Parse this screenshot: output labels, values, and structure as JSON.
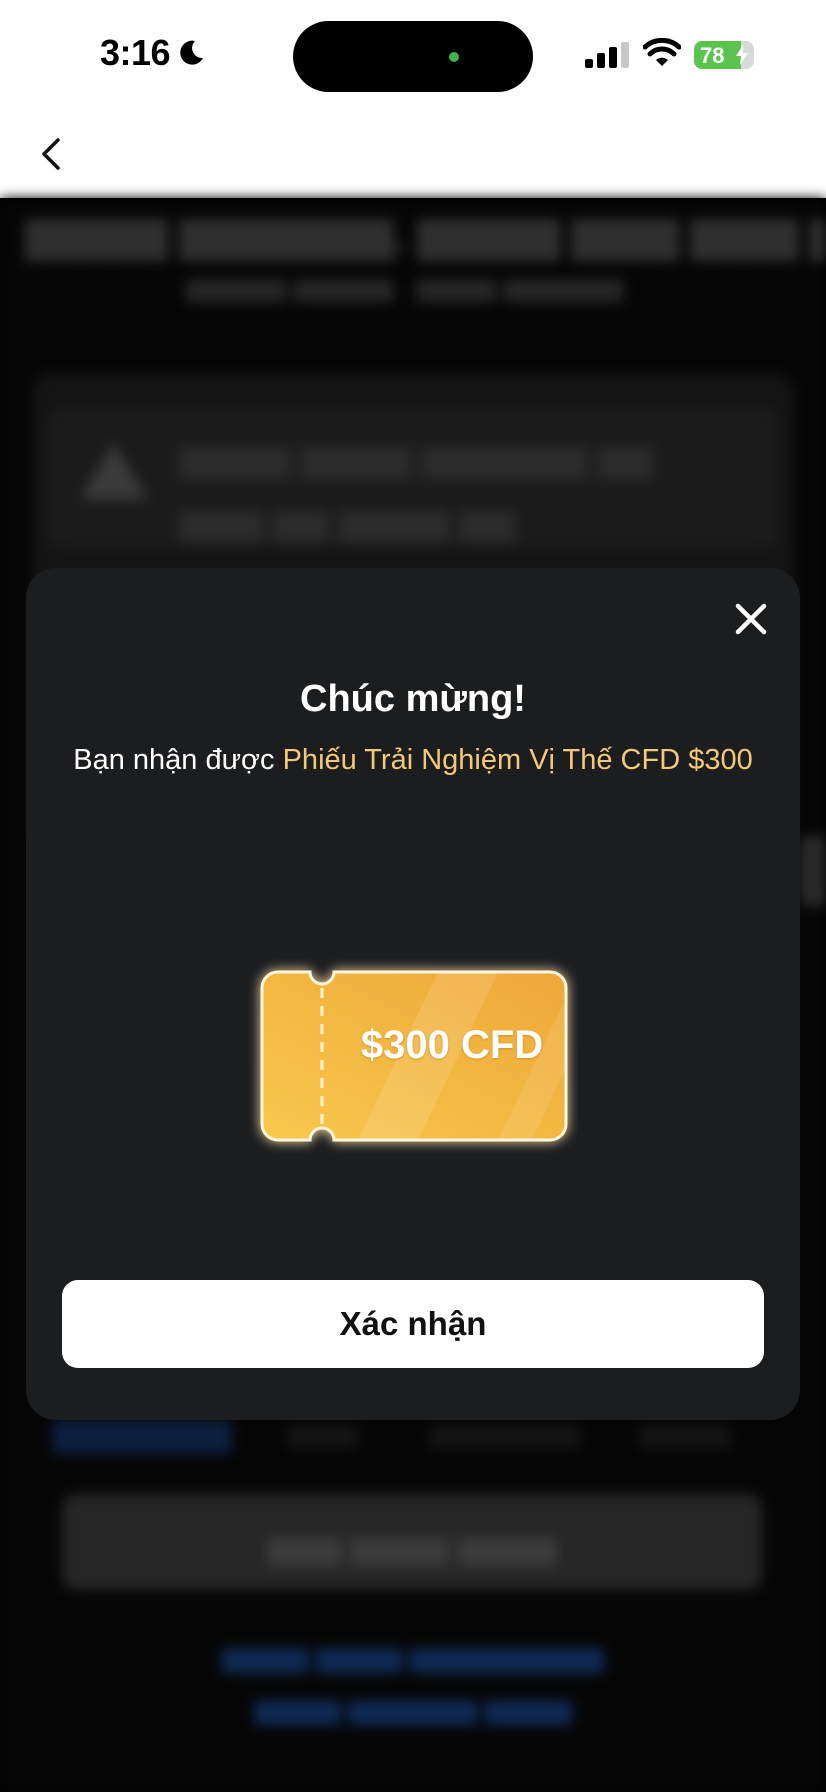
{
  "status_bar": {
    "time": "3:16",
    "battery_percent": "78",
    "battery_level": 0.78,
    "icons": [
      "moon-icon",
      "signal-icon",
      "wifi-icon",
      "battery-icon",
      "charging-bolt-icon"
    ]
  },
  "nav": {
    "back_icon": "chevron-left-icon"
  },
  "modal": {
    "title": "Chúc mừng!",
    "message_prefix": "Bạn nhận được ",
    "message_highlight": "Phiếu Trải Nghiệm Vị Thế CFD $300",
    "ticket_label": "$300 CFD",
    "confirm_label": "Xác nhận",
    "close_icon": "close-icon"
  },
  "colors": {
    "highlight": "#f3c87a",
    "modal_bg": "#1c1d1f",
    "ticket_gold": "#f2b640"
  }
}
